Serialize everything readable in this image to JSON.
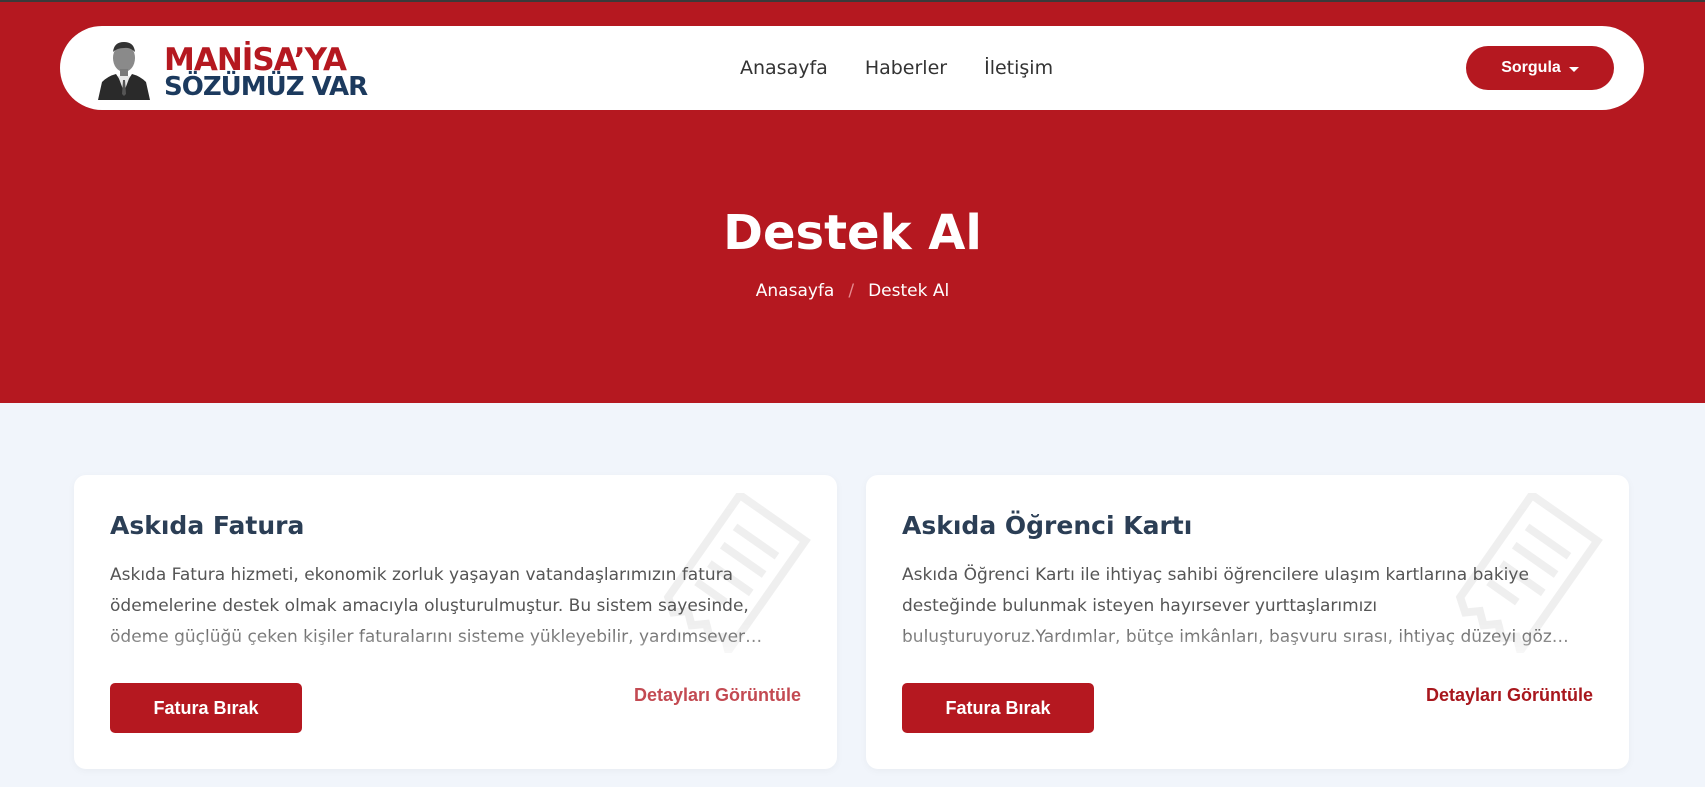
{
  "brand": {
    "line1": "MANİSA’YA",
    "line2": "SÖZÜMÜZ VAR",
    "color_primary": "#b51820",
    "color_secondary": "#1c3a5e"
  },
  "nav": {
    "links": [
      {
        "label": "Anasayfa"
      },
      {
        "label": "Haberler"
      },
      {
        "label": "İletişim"
      }
    ],
    "dropdown_label": "Sorgula"
  },
  "hero": {
    "title": "Destek Al",
    "breadcrumb": {
      "home": "Anasayfa",
      "separator": "/",
      "current": "Destek Al"
    }
  },
  "cards": [
    {
      "title": "Askıda Fatura",
      "description": "Askıda Fatura hizmeti, ekonomik zorluk yaşayan vatandaşlarımızın fatura ödemelerine destek olmak amacıyla oluşturulmuştur. Bu sistem sayesinde, ödeme güçlüğü çeken kişiler faturalarını sisteme yükleyebilir, yardımsever vatandaşlarımız ise bu faturaları ödeyerek destek olabilir.",
      "button_label": "Fatura Bırak",
      "link_label": "Detayları Görüntüle",
      "icon": "receipt-icon"
    },
    {
      "title": "Askıda Öğrenci Kartı",
      "description": "Askıda Öğrenci Kartı ile ihtiyaç sahibi öğrencilere ulaşım kartlarına bakiye desteğinde bulunmak isteyen hayırsever yurttaşlarımızı buluşturuyoruz.Yardımlar, bütçe imkânları, başvuru sırası, ihtiyaç düzeyi göz önünde bulundurularak yapılmaktadır.",
      "button_label": "Fatura Bırak",
      "link_label": "Detayları Görüntüle",
      "icon": "receipt-icon"
    }
  ]
}
